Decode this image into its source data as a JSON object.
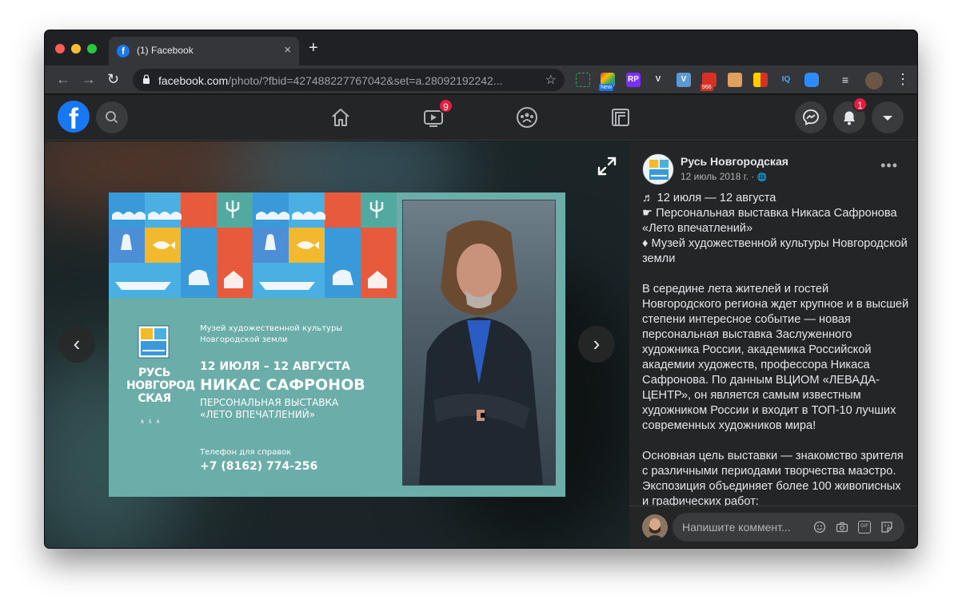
{
  "browser": {
    "tab_title": "(1) Facebook",
    "tab_close": "×",
    "new_tab": "+",
    "back": "←",
    "forward": "→",
    "reload": "↻",
    "url_host": "facebook.com",
    "url_path": "/photo/?fbid=427488227767042&set=a.28092192242...",
    "bookmark_star": "☆",
    "extensions": {
      "badge_new": "New",
      "ext_rp": "RP",
      "ext_v": "V",
      "ext_v_blue": "V",
      "mail_count": "966",
      "ext_iq": "IQ"
    },
    "menu": "⋮"
  },
  "facebook": {
    "logo": "f",
    "watch_badge": "9",
    "notifications_badge": "1"
  },
  "poster": {
    "museum": "Музей художественной культуры\nНовгородской земли",
    "dates": "12 ИЮЛЯ – 12 АВГУСТА",
    "artist": "НИКАС САФРОНОВ",
    "exhibition": "ПЕРСОНАЛЬНАЯ ВЫСТАВКА\n«ЛЕТО ВПЕЧАТЛЕНИЙ»",
    "phone_label": "Телефон для справок",
    "phone": "+7 (8162) 774-256",
    "brand": "РУСЬ\nНОВГОРОД\nСКАЯ",
    "brand_year": "8 5 9"
  },
  "viewer": {
    "prev": "‹",
    "next": "›"
  },
  "post": {
    "page_name": "Русь Новгородская",
    "date": "12 июль 2018 г. · ",
    "globe": "🌐",
    "more": "•••",
    "paragraphs": [
      "♬ 12 июля — 12 августа\n☛ Персональная выставка Никаса Сафронова «Лето впечатлений»\n♦ Музей художественной культуры Новгородской земли",
      "В середине лета жителей и гостей Новгородского региона ждет крупное и в высшей степени интересное событие — новая персональная выставка Заслуженного художника России, академика Российской академии художеств, профессора Никаса Сафронова. По данным ВЦИОМ «ЛЕВАДА-ЦЕНТР», он является самым известным художником России и входит в ТОП-10 лучших современных художников мира!",
      "Основная цель выставки — знакомство зрителя с различными периодами творчества маэстро. Экспозиция объединяет более 100 живописных и графических работ:"
    ],
    "comment_placeholder": "Напишите коммент...",
    "gif": "GIF"
  },
  "colors": {
    "fb_blue": "#1877f2",
    "badge_red": "#e41e3f",
    "poster_teal": "#6aada9"
  }
}
